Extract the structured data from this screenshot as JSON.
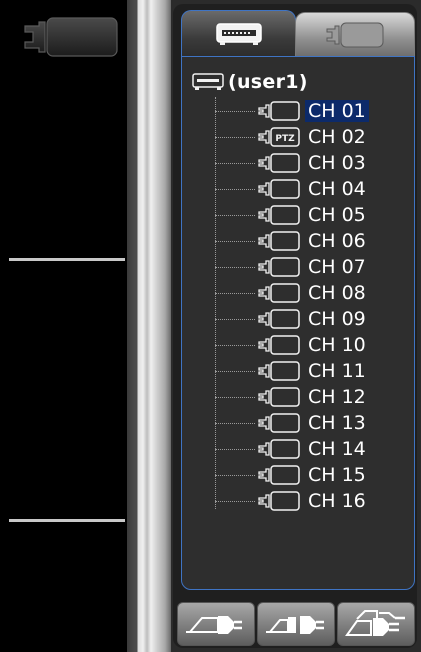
{
  "left_panel": {
    "cell_icon": "video-camera-icon"
  },
  "tabs": [
    {
      "name": "device-tab",
      "icon": "dvr-device-icon",
      "selected": true
    },
    {
      "name": "camera-tab",
      "icon": "video-camera-icon",
      "selected": false
    }
  ],
  "tree": {
    "root_label": "(user1)",
    "root_icon": "dvr-device-icon",
    "channels": [
      {
        "label": "CH 01",
        "ptz": false,
        "selected": true
      },
      {
        "label": "CH 02",
        "ptz": true,
        "ptz_text": "PTZ",
        "selected": false
      },
      {
        "label": "CH 03",
        "ptz": false,
        "selected": false
      },
      {
        "label": "CH 04",
        "ptz": false,
        "selected": false
      },
      {
        "label": "CH 05",
        "ptz": false,
        "selected": false
      },
      {
        "label": "CH 06",
        "ptz": false,
        "selected": false
      },
      {
        "label": "CH 07",
        "ptz": false,
        "selected": false
      },
      {
        "label": "CH 08",
        "ptz": false,
        "selected": false
      },
      {
        "label": "CH 09",
        "ptz": false,
        "selected": false
      },
      {
        "label": "CH 10",
        "ptz": false,
        "selected": false
      },
      {
        "label": "CH 11",
        "ptz": false,
        "selected": false
      },
      {
        "label": "CH 12",
        "ptz": false,
        "selected": false
      },
      {
        "label": "CH 13",
        "ptz": false,
        "selected": false
      },
      {
        "label": "CH 14",
        "ptz": false,
        "selected": false
      },
      {
        "label": "CH 15",
        "ptz": false,
        "selected": false
      },
      {
        "label": "CH 16",
        "ptz": false,
        "selected": false
      }
    ]
  },
  "bottom_buttons": [
    {
      "name": "connect-button",
      "icon": "connect-plug-icon"
    },
    {
      "name": "disconnect-button",
      "icon": "disconnect-plug-icon"
    },
    {
      "name": "connect-all-button",
      "icon": "connect-all-plugs-icon"
    }
  ],
  "colors": {
    "selection": "#0c2a6a",
    "panel_border": "#3f74c4",
    "panel_bg": "#2e2e2e"
  }
}
